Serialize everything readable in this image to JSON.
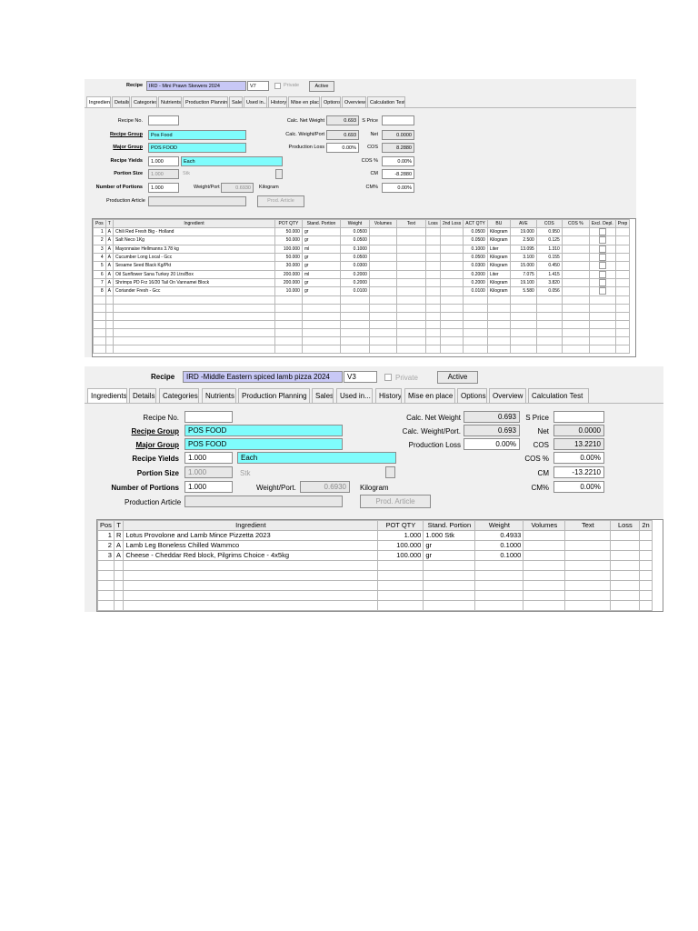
{
  "panel1": {
    "recipe_label": "Recipe",
    "recipe_name": "IRD - Mini Prawn Skewers 2024",
    "version": "V7",
    "private_label": "Private",
    "active_label": "Active",
    "tabs": [
      "Ingredients",
      "Details",
      "Categories",
      "Nutrients",
      "Production Planning",
      "Sales",
      "Used in...",
      "History",
      "Mise en place",
      "Options",
      "Overview",
      "Calculation Test"
    ],
    "labels": {
      "recipe_no": "Recipe No.",
      "recipe_group": "Recipe Group",
      "major_group": "Major Group",
      "recipe_yields": "Recipe Yields",
      "portion_size": "Portion Size",
      "num_portions": "Number of Portions",
      "weight_port": "Weight/Port",
      "kilogram": "Kilogram",
      "production_article": "Production Article",
      "prod_article_btn": "Prod. Article",
      "calc_net_weight": "Calc. Net Weight",
      "calc_weight_port": "Calc. Weight/Port",
      "production_loss": "Production Loss",
      "s_price": "S Price",
      "net": "Net",
      "cos": "COS",
      "cos_pct": "COS %",
      "cm": "CM",
      "cm_pct": "CM%"
    },
    "values": {
      "recipe_no": "",
      "recipe_group": "Pos Food",
      "major_group": "POS FOOD",
      "yields_qty": "1.000",
      "yields_unit": "Each",
      "portion_size": "1.000",
      "portion_unit": "Stk",
      "num_portions": "1.000",
      "weight_port": "0.6930",
      "production_article": "",
      "calc_net_weight": "0.693",
      "calc_weight_port": "0.693",
      "production_loss": "0.00%",
      "s_price": "",
      "net": "0.0000",
      "cos": "8.2880",
      "cos_pct": "0.00%",
      "cm": "-8.2880",
      "cm_pct": "0.00%"
    },
    "columns": [
      "Pos",
      "T",
      "Ingredient",
      "POT QTY",
      "Stand. Portion",
      "Weight",
      "Volumes",
      "Text",
      "Loss",
      "2nd Loss",
      "ACT QTY",
      "BU",
      "AVE",
      "COS",
      "COS %",
      "Excl. Depl.",
      "Prep"
    ],
    "rows": [
      [
        "1",
        "A",
        "Chili Red Fresh Big - Holland",
        "50.000",
        "gr",
        "0.0500",
        "",
        "",
        "",
        "",
        "0.0500",
        "Kilogram",
        "19.000",
        "0.950",
        "",
        "",
        ""
      ],
      [
        "2",
        "A",
        "Salt Neco 1Kg",
        "50.000",
        "gr",
        "0.0500",
        "",
        "",
        "",
        "",
        "0.0500",
        "Kilogram",
        "2.500",
        "0.125",
        "",
        "",
        ""
      ],
      [
        "3",
        "A",
        "Mayonnaise Hellmanns 3.78 kg",
        "100.000",
        "ml",
        "0.1000",
        "",
        "",
        "",
        "",
        "0.1000",
        "Liter",
        "13.095",
        "1.310",
        "",
        "",
        ""
      ],
      [
        "4",
        "A",
        "Cucumber Long Local - Gcc",
        "50.000",
        "gr",
        "0.0500",
        "",
        "",
        "",
        "",
        "0.0500",
        "Kilogram",
        "3.100",
        "0.155",
        "",
        "",
        ""
      ],
      [
        "5",
        "A",
        "Sesame Seed Black Kg/Pkt",
        "30.000",
        "gr",
        "0.0300",
        "",
        "",
        "",
        "",
        "0.0300",
        "Kilogram",
        "15.000",
        "0.450",
        "",
        "",
        ""
      ],
      [
        "6",
        "A",
        "Oil Sunflower Sana Turkey 20 Ltrs/Box",
        "200.000",
        "ml",
        "0.2000",
        "",
        "",
        "",
        "",
        "0.2000",
        "Liter",
        "7.075",
        "1.415",
        "",
        "",
        ""
      ],
      [
        "7",
        "A",
        "Shrimps PD Frz 16/20 Tail On Vannamei Block",
        "200.000",
        "gr",
        "0.2000",
        "",
        "",
        "",
        "",
        "0.2000",
        "Kilogram",
        "19.100",
        "3.820",
        "",
        "",
        ""
      ],
      [
        "8",
        "A",
        "Coriander Fresh - Gcc",
        "10.000",
        "gr",
        "0.0100",
        "",
        "",
        "",
        "",
        "0.0100",
        "Kilogram",
        "5.580",
        "0.056",
        "",
        "",
        ""
      ]
    ]
  },
  "panel2": {
    "recipe_label": "Recipe",
    "recipe_name": "IRD -Middle Eastern spiced lamb pizza 2024",
    "version": "V3",
    "private_label": "Private",
    "active_label": "Active",
    "tabs": [
      "Ingredients",
      "Details",
      "Categories",
      "Nutrients",
      "Production Planning",
      "Sales",
      "Used in...",
      "History",
      "Mise en place",
      "Options",
      "Overview",
      "Calculation Test"
    ],
    "labels": {
      "recipe_no": "Recipe No.",
      "recipe_group": "Recipe Group",
      "major_group": "Major Group",
      "recipe_yields": "Recipe Yields",
      "portion_size": "Portion Size",
      "num_portions": "Number of Portions",
      "weight_port": "Weight/Port.",
      "kilogram": "Kilogram",
      "production_article": "Production Article",
      "prod_article_btn": "Prod. Article",
      "calc_net_weight": "Calc. Net Weight",
      "calc_weight_port": "Calc. Weight/Port.",
      "production_loss": "Production Loss",
      "s_price": "S Price",
      "net": "Net",
      "cos": "COS",
      "cos_pct": "COS %",
      "cm": "CM",
      "cm_pct": "CM%"
    },
    "values": {
      "recipe_no": "",
      "recipe_group": "POS FOOD",
      "major_group": "POS FOOD",
      "yields_qty": "1.000",
      "yields_unit": "Each",
      "portion_size": "1.000",
      "portion_unit": "Stk",
      "num_portions": "1.000",
      "weight_port": "0.6930",
      "production_article": "",
      "calc_net_weight": "0.693",
      "calc_weight_port": "0.693",
      "production_loss": "0.00%",
      "s_price": "",
      "net": "0.0000",
      "cos": "13.2210",
      "cos_pct": "0.00%",
      "cm": "-13.2210",
      "cm_pct": "0.00%"
    },
    "columns": [
      "Pos",
      "T",
      "Ingredient",
      "POT QTY",
      "Stand. Portion",
      "Weight",
      "Volumes",
      "Text",
      "Loss",
      "2n"
    ],
    "rows": [
      [
        "1",
        "R",
        "Lotus Provolone and Lamb Mince Pizzetta  2023",
        "1.000",
        "1.000 Stk",
        "0.4933",
        "",
        "",
        "",
        ""
      ],
      [
        "2",
        "A",
        "Lamb Leg Boneless Chilled Wammco",
        "100.000",
        "gr",
        "0.1000",
        "",
        "",
        "",
        ""
      ],
      [
        "3",
        "A",
        "Cheese - Cheddar Red block, Pilgrims Choice - 4x5kg",
        "100.000",
        "gr",
        "0.1000",
        "",
        "",
        "",
        ""
      ]
    ]
  }
}
